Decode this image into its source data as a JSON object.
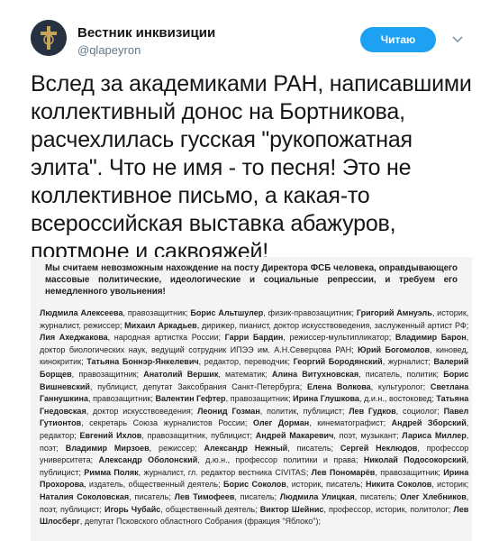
{
  "account": {
    "name": "Вестник инквизиции",
    "handle": "@qlapeyron",
    "follow_label": "Читаю",
    "more_icon": "chevron-down-icon",
    "avatar_icon": "cross-emblem-icon"
  },
  "tweet": {
    "text": "Вслед за академиками РАН, написавшими коллективный донос на Бортникова, расчехлилась гусская \"рукопожатная элита\". Что не имя - то песня! Это не коллективное письмо, а какая-то всероссийская выставка абажуров, портмоне и саквояжей!"
  },
  "document": {
    "intro": "Мы считаем невозможным нахождение на посту Директора ФСБ человека, оправдывающего массовые политические, идеологические и социальные репрессии, и требуем его немедленного увольнения!",
    "signatories": [
      {
        "name": "Людмила Алексеева",
        "role": "правозащитник"
      },
      {
        "name": "Борис Альтшулер",
        "role": "физик-правозащитник"
      },
      {
        "name": "Григорий Амнуэль",
        "role": "историк, журналист, режиссер"
      },
      {
        "name": "Михаил Аркадьев",
        "role": "дирижер, пианист, доктор искусствоведения, заслуженный артист РФ"
      },
      {
        "name": "Лия Ахеджакова",
        "role": "народная артистка России"
      },
      {
        "name": "Гарри Бардин",
        "role": "режиссер-мультипликатор"
      },
      {
        "name": "Владимир Барон",
        "role": "доктор биологических наук, ведущий сотрудник ИПЭЭ им. А.Н.Северцова РАН"
      },
      {
        "name": "Юрий Богомолов",
        "role": "киновед, кинокритик"
      },
      {
        "name": "Татьяна Боннэр-Янкелевич",
        "role": "редактор, переводчик"
      },
      {
        "name": "Георгий Бородянский",
        "role": "журналист"
      },
      {
        "name": "Валерий Борщев",
        "role": "правозащитник"
      },
      {
        "name": "Анатолий Вершик",
        "role": "математик"
      },
      {
        "name": "Алина Витухновская",
        "role": "писатель, политик"
      },
      {
        "name": "Борис Вишневский",
        "role": "публицист, депутат Заксобрания Санкт-Петербурга"
      },
      {
        "name": "Елена Волкова",
        "role": "культуролог"
      },
      {
        "name": "Светлана Ганнушкина",
        "role": "правозащитник"
      },
      {
        "name": "Валентин Гефтер",
        "role": "правозащитник"
      },
      {
        "name": "Ирина Глушкова",
        "role": "д.и.н., востоковед"
      },
      {
        "name": "Татьяна Гнедовская",
        "role": "доктор искусствоведения"
      },
      {
        "name": "Леонид Гозман",
        "role": "политик, публицист"
      },
      {
        "name": "Лев Гудков",
        "role": "социолог"
      },
      {
        "name": "Павел Гутионтов",
        "role": "секретарь Союза журналистов России"
      },
      {
        "name": "Олег Дорман",
        "role": "кинематографист"
      },
      {
        "name": "Андрей Зборский",
        "role": "редактор"
      },
      {
        "name": "Евгений Ихлов",
        "role": "правозащитник, публицист"
      },
      {
        "name": "Андрей Макаревич",
        "role": "поэт, музыкант"
      },
      {
        "name": "Лариса Миллер",
        "role": "поэт"
      },
      {
        "name": "Владимир Мирзоев",
        "role": "режиссер"
      },
      {
        "name": "Александр Нежный",
        "role": "писатель"
      },
      {
        "name": "Сергей Неклюдов",
        "role": "профессор университета"
      },
      {
        "name": "Александр Оболонский",
        "role": "д.ю.н., профессор политики и права"
      },
      {
        "name": "Николай Подосокорский",
        "role": "публицист"
      },
      {
        "name": "Римма Поляк",
        "role": "журналист, гл. редактор вестника CIVITAS"
      },
      {
        "name": "Лев Пономарёв",
        "role": "правозащитник"
      },
      {
        "name": "Ирина Прохорова",
        "role": "издатель, общественный деятель"
      },
      {
        "name": "Борис Соколов",
        "role": "историк, писатель"
      },
      {
        "name": "Никита Соколов",
        "role": "историк"
      },
      {
        "name": "Наталия Соколовская",
        "role": "писатель"
      },
      {
        "name": "Лев Тимофеев",
        "role": "писатель"
      },
      {
        "name": "Людмила Улицкая",
        "role": "писатель"
      },
      {
        "name": "Олег Хлебников",
        "role": "поэт, публицист"
      },
      {
        "name": "Игорь Чубайс",
        "role": "общественный деятель"
      },
      {
        "name": "Виктор Шейнис",
        "role": "профессор, историк, политолог"
      },
      {
        "name": "Лев Шлосберг",
        "role": "депутат Псковского областного Собрания (фракция \"Яблоко\")"
      }
    ]
  }
}
